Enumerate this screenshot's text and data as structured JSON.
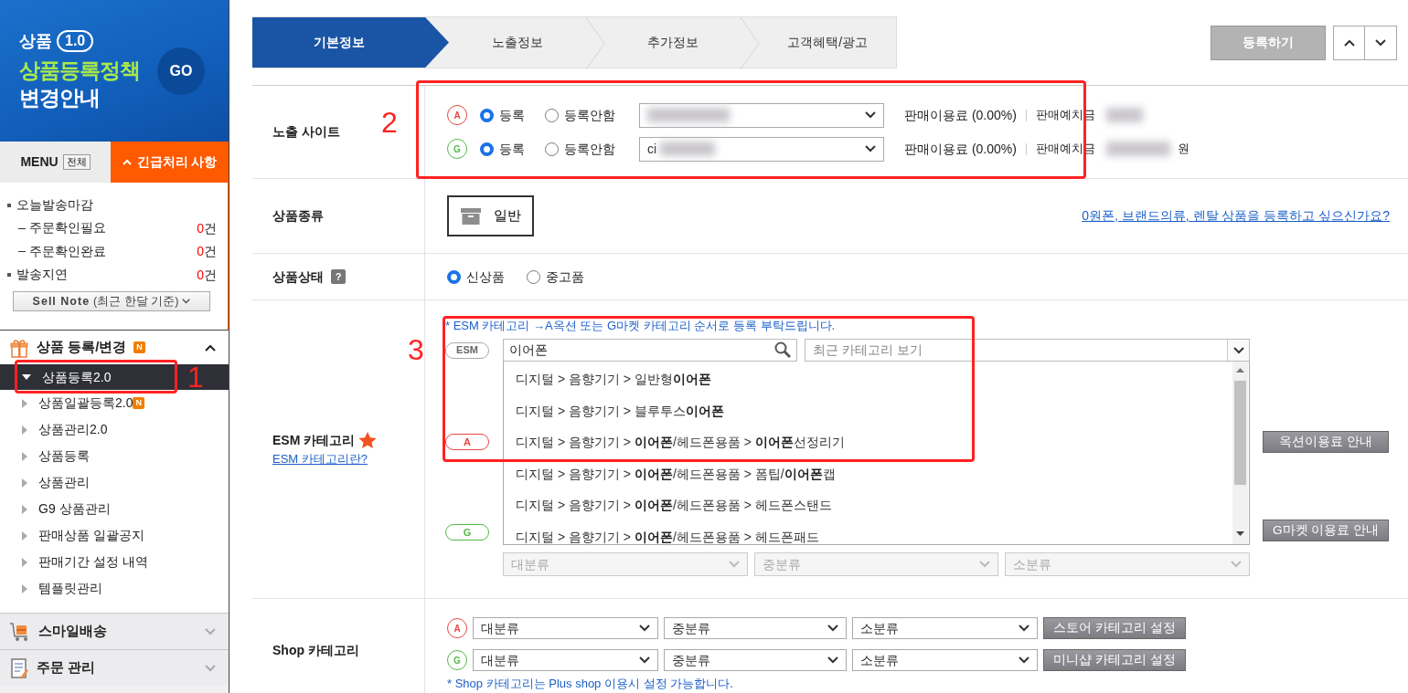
{
  "banner": {
    "label": "상품",
    "version": "1.0",
    "headline": "상품등록정책",
    "subline": "변경안내",
    "go": "GO"
  },
  "menu_bar": {
    "menu": "MENU",
    "all": "전체",
    "urgent": "긴급처리 사항"
  },
  "urgent_items": [
    {
      "kind": "group",
      "label": "오늘발송마감"
    },
    {
      "kind": "sub",
      "label": "주문확인필요",
      "count": "0",
      "unit": "건"
    },
    {
      "kind": "sub",
      "label": "주문확인완료",
      "count": "0",
      "unit": "건"
    },
    {
      "kind": "group",
      "label": "발송지연",
      "count": "0",
      "unit": "건"
    }
  ],
  "sell_note": {
    "label": "Sell Note",
    "hint": "(최근 한달 기준)"
  },
  "nav_sections": [
    {
      "title": "상품 등록/변경",
      "badge": "N",
      "expanded": true,
      "children": [
        {
          "label": "상품등록2.0",
          "selected": true
        },
        {
          "label": "상품일괄등록2.0",
          "selected": false,
          "badge": "N"
        },
        {
          "label": "상품관리2.0",
          "selected": false
        },
        {
          "label": "상품등록",
          "selected": false
        },
        {
          "label": "상품관리",
          "selected": false
        },
        {
          "label": "G9 상품관리",
          "selected": false
        },
        {
          "label": "판매상품 일괄공지",
          "selected": false
        },
        {
          "label": "판매기간 설정 내역",
          "selected": false
        },
        {
          "label": "템플릿관리",
          "selected": false
        }
      ]
    },
    {
      "title": "스마일배송",
      "expanded": false
    },
    {
      "title": "주문 관리",
      "expanded": false
    }
  ],
  "steps": [
    {
      "label": "기본정보",
      "selected": true
    },
    {
      "label": "노출정보",
      "selected": false
    },
    {
      "label": "추가정보",
      "selected": false
    },
    {
      "label": "고객혜택/광고",
      "selected": false
    }
  ],
  "register_button": "등록하기",
  "exposure": {
    "label": "노출 사이트",
    "sites": [
      {
        "market": "A",
        "color": "#e8473f",
        "options": [
          {
            "label": "등록",
            "selected": true
          },
          {
            "label": "등록안함",
            "selected": false
          }
        ],
        "fee": "판매이용료 (0.00%)",
        "deposit": "판매예치금"
      },
      {
        "market": "G",
        "color": "#53b848",
        "options": [
          {
            "label": "등록",
            "selected": true
          },
          {
            "label": "등록안함",
            "selected": false
          }
        ],
        "account": "ci",
        "fee": "판매이용료 (0.00%)",
        "deposit": "판매예치금",
        "unit": "원"
      }
    ]
  },
  "product_type": {
    "label": "상품종류",
    "option": "일반",
    "link": "0원폰, 브랜드의류, 렌탈 상품을 등록하고 싶으신가요?"
  },
  "product_condition": {
    "label": "상품상태",
    "help": "?",
    "options": [
      {
        "label": "신상품",
        "selected": true
      },
      {
        "label": "중고품",
        "selected": false
      }
    ]
  },
  "esm_category": {
    "label": "ESM 카테고리",
    "link": "ESM 카테고리란?",
    "note": "* ESM 카테고리 →A옥션 또는 G마켓 카테고리 순서로 등록 부탁드립니다.",
    "tag": "ESM",
    "search_value": "이어폰",
    "recent_placeholder": "최근 카테고리 보기",
    "suggestions": [
      "디지털 > 음향기기 > 일반형**이어폰**",
      "디지털 > 음향기기 > 블루투스**이어폰**",
      "디지털 > 음향기기 > **이어폰**/헤드폰용품 > **이어폰**선정리기",
      "디지털 > 음향기기 > **이어폰**/헤드폰용품 > 폼팁/**이어폰**캡",
      "디지털 > 음향기기 > **이어폰**/헤드폰용품 > 헤드폰스탠드",
      "디지털 > 음향기기 > **이어폰**/헤드폰용품 > 헤드폰패드"
    ],
    "markets": [
      {
        "tag": "A",
        "color": "#e8473f",
        "button": "옥션이용료 안내"
      },
      {
        "tag": "G",
        "color": "#53b848",
        "button": "G마켓 이용료 안내"
      }
    ],
    "levels": [
      {
        "label": "대분류",
        "disabled": true
      },
      {
        "label": "중분류",
        "disabled": true
      },
      {
        "label": "소분류",
        "disabled": true
      }
    ]
  },
  "shop_category": {
    "label": "Shop 카테고리",
    "rows": [
      {
        "tag": "A",
        "color": "#e8473f",
        "selects": [
          {
            "label": "대분류",
            "disabled": false
          },
          {
            "label": "중분류",
            "disabled": false
          },
          {
            "label": "소분류",
            "disabled": false
          }
        ],
        "button": "스토어 카테고리 설정"
      },
      {
        "tag": "G",
        "color": "#53b848",
        "selects": [
          {
            "label": "대분류",
            "disabled": false
          },
          {
            "label": "중분류",
            "disabled": false
          },
          {
            "label": "소분류",
            "disabled": false
          }
        ],
        "button": "미니샵 카테고리 설정"
      }
    ],
    "note": "* Shop 카테고리는 Plus shop 이용시 설정 가능합니다."
  },
  "annotations": [
    {
      "label": "1"
    },
    {
      "label": "2"
    },
    {
      "label": "3"
    }
  ]
}
